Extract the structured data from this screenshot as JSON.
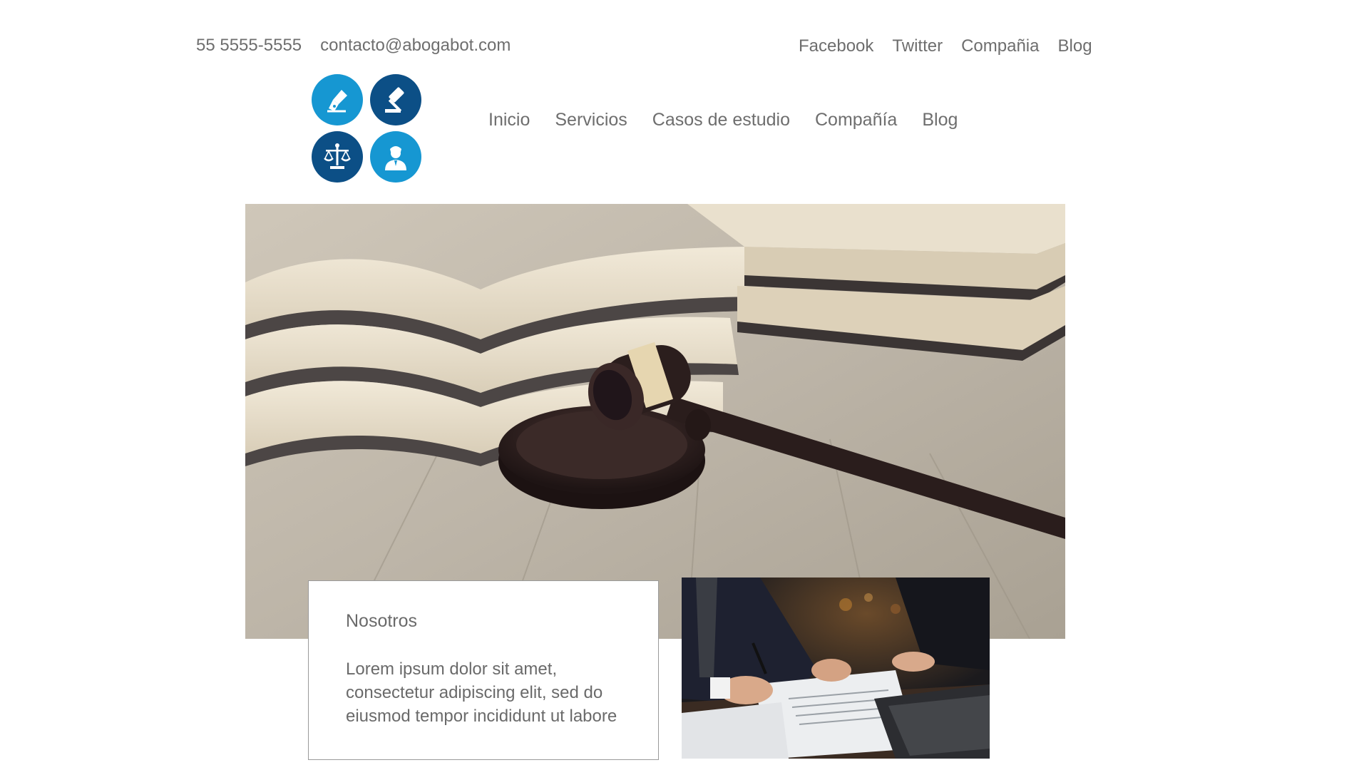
{
  "topbar": {
    "phone": "55 5555-5555",
    "email": "contacto@abogabot.com",
    "social_links": [
      {
        "label": "Facebook"
      },
      {
        "label": "Twitter"
      },
      {
        "label": "Compañia"
      },
      {
        "label": "Blog"
      }
    ]
  },
  "logo": {
    "icons": [
      "pen-nib-icon",
      "gavel-icon",
      "scales-icon",
      "lawyer-icon"
    ],
    "colors": {
      "light_blue": "#1697d2",
      "dark_blue": "#0c4f86"
    }
  },
  "nav": {
    "items": [
      {
        "label": "Inicio"
      },
      {
        "label": "Servicios"
      },
      {
        "label": "Casos de estudio"
      },
      {
        "label": "Compañía"
      },
      {
        "label": "Blog"
      }
    ]
  },
  "about": {
    "title": "Nosotros",
    "text": "Lorem ipsum dolor sit amet,\n consectetur adipiscing elit, sed do\neiusmod tempor incididunt ut labore"
  }
}
